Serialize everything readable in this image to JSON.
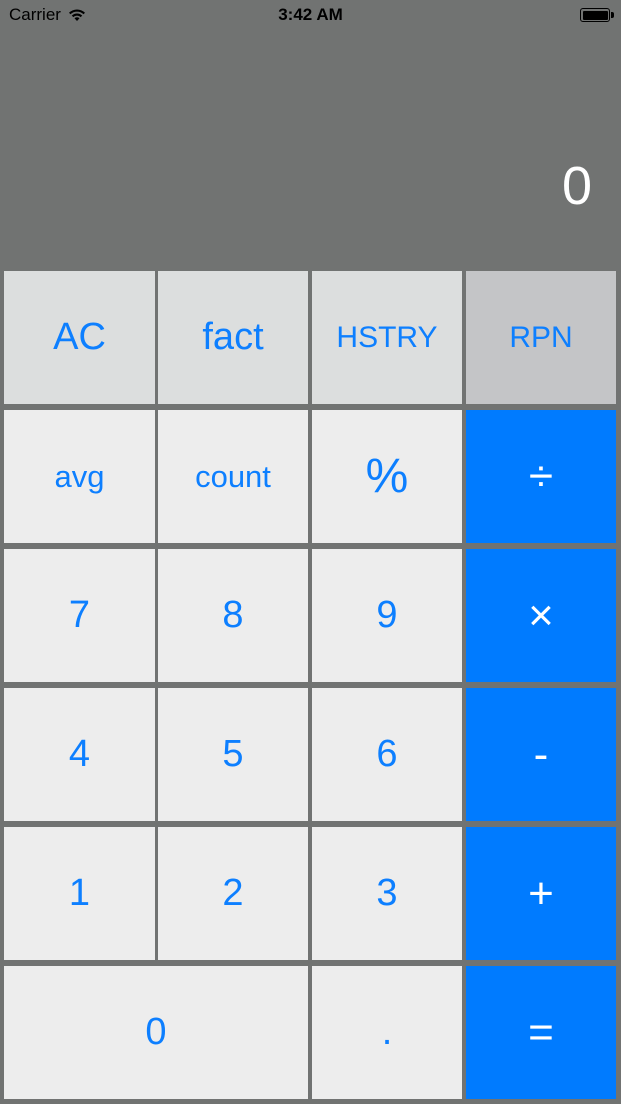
{
  "status_bar": {
    "carrier": "Carrier",
    "time": "3:42 AM"
  },
  "display": {
    "value": "0"
  },
  "colors": {
    "background": "#717372",
    "utility_key": "#dcdede",
    "rpn_key": "#c4c5c7",
    "number_key": "#ededed",
    "operator_key": "#007bff",
    "key_text": "#0d7fff"
  },
  "keys": {
    "ac": "AC",
    "fact": "fact",
    "history": "HSTRY",
    "rpn": "RPN",
    "avg": "avg",
    "count": "count",
    "percent": "%",
    "divide": "÷",
    "seven": "7",
    "eight": "8",
    "nine": "9",
    "multiply": "×",
    "four": "4",
    "five": "5",
    "six": "6",
    "minus": "-",
    "one": "1",
    "two": "2",
    "three": "3",
    "plus": "+",
    "zero": "0",
    "decimal": ".",
    "equals": "="
  }
}
